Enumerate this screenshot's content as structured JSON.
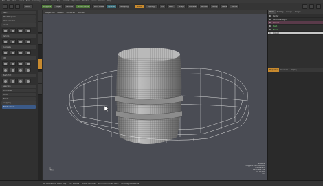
{
  "menubar": {
    "items": [
      "File",
      "Edit",
      "View",
      "Select",
      "Item",
      "Geometry",
      "Texture",
      "Vertex Map",
      "Animate",
      "Dynamics",
      "Render",
      "Layout",
      "System",
      "Help"
    ]
  },
  "toolbar": {
    "buttons": [
      "Model",
      "Topology",
      "UV",
      "Paint",
      "Sculpt",
      "Animate",
      "Render",
      "Setup",
      "Game",
      "Layout"
    ],
    "mode_labels": [
      "Items",
      "Polygons",
      "Edges",
      "Vertices",
      "Action Center",
      "Work Plane",
      "Symmetry",
      "Snapping"
    ]
  },
  "left_panel": {
    "sections": [
      "Basic",
      "Create",
      "Deform",
      "Duplicate",
      "Edit",
      "Mesh Edit",
      "Selection",
      "Snapping"
    ],
    "rows": [
      "Mesh Properties",
      "Item Selection",
      "Edit Mode",
      "Curve",
      "Falloff"
    ],
    "active_row": "Falloff: Linear"
  },
  "viewport": {
    "tabs": [
      "Perspective",
      "Default",
      "Advanced",
      "Gouraud"
    ],
    "info_lines": [
      "No Items",
      "Polygons: Catmull-Clark",
      "Channels: 0",
      "Deformers: ON",
      "GL: 17,592",
      "1m"
    ]
  },
  "right_panel": {
    "tabs": [
      "Items",
      "Shading",
      "Groups",
      "Images"
    ],
    "items": [
      "Render",
      "Directional Light",
      "Camera",
      "Mesh",
      "Barrel",
      "Ground"
    ],
    "props_tabs": [
      "Properties",
      "Channels",
      "Display"
    ]
  },
  "statusbar": {
    "items": [
      "Left Double Click: Select Loop",
      "Ctrl: Remove",
      "Middle: Pan View",
      "Right Click: Context Menu",
      "Alt+Drag: Rotate View"
    ]
  },
  "colors": {
    "accent": "#c88a2e",
    "viewport_bg": "#4a4c54",
    "mesh_wire": "#e0e0e0"
  }
}
